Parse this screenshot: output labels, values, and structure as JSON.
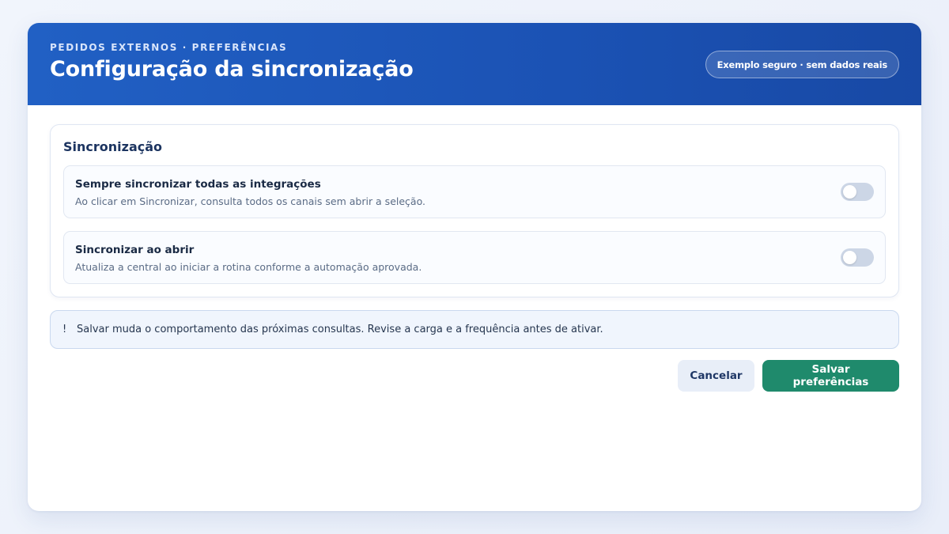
{
  "header": {
    "eyebrow": "PEDIDOS EXTERNOS · PREFERÊNCIAS",
    "title": "Configuração da sincronização",
    "badge": "Exemplo seguro · sem dados reais"
  },
  "section": {
    "title": "Sincronização",
    "settings": [
      {
        "label": "Sempre sincronizar todas as integrações",
        "description": "Ao clicar em Sincronizar, consulta todos os canais sem abrir a seleção.",
        "enabled": false
      },
      {
        "label": "Sincronizar ao abrir",
        "description": "Atualiza a central ao iniciar a rotina conforme a automação aprovada.",
        "enabled": false
      }
    ]
  },
  "notice": {
    "icon": "!",
    "text": "Salvar muda o comportamento das próximas consultas. Revise a carga e a frequência antes de ativar."
  },
  "actions": {
    "cancel_label": "Cancelar",
    "save_label": "Salvar preferências"
  },
  "colors": {
    "header": "#1f5bbd",
    "primary_button": "#1f8a6c",
    "toggle_off": "#ccd6e6"
  }
}
